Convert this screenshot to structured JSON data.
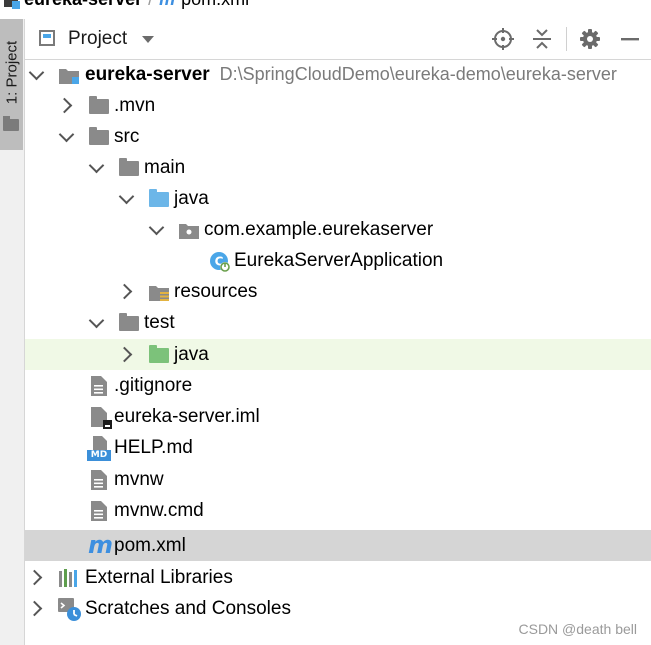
{
  "breadcrumb": {
    "module": "eureka-server",
    "separator": "/",
    "file_icon": "m",
    "file": "pom.xml"
  },
  "side_tab": {
    "label": "1: Project"
  },
  "header": {
    "title": "Project"
  },
  "tree": {
    "root": {
      "name": "eureka-server",
      "path": "D:\\SpringCloudDemo\\eureka-demo\\eureka-server"
    },
    "mvn": ".mvn",
    "src": "src",
    "main": "main",
    "main_java": "java",
    "package": "com.example.eurekaserver",
    "app_class": "EurekaServerApplication",
    "resources": "resources",
    "test": "test",
    "test_java": "java",
    "gitignore": ".gitignore",
    "iml": "eureka-server.iml",
    "help": "HELP.md",
    "help_badge": "MD",
    "mvnw": "mvnw",
    "mvnw_cmd": "mvnw.cmd",
    "pom_icon": "m",
    "pom": "pom.xml",
    "external_libraries": "External Libraries",
    "scratches": "Scratches and Consoles"
  },
  "colors": {
    "selection": "#d5d5d5",
    "test_highlight": "#f0f9e6",
    "folder_gray": "#8a8a8a",
    "source_blue": "#6cb6e8",
    "test_green": "#7cc27a"
  },
  "watermark": "CSDN @death bell"
}
